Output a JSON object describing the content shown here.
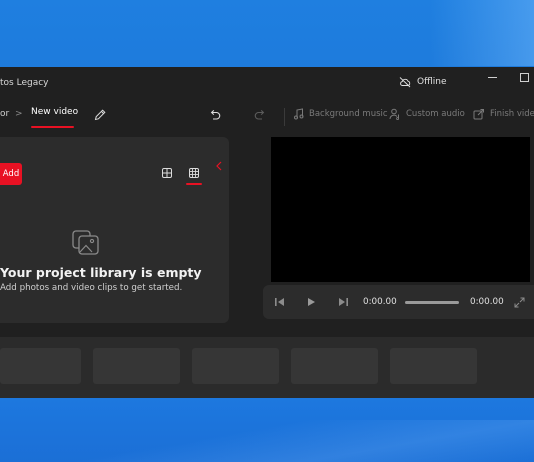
{
  "window": {
    "title": "tos Legacy",
    "status": "Offline",
    "status_icon": "cloud-off-icon"
  },
  "toolbar": {
    "breadcrumb_prev": "or",
    "breadcrumb_separator": ">",
    "breadcrumb_current": "New video",
    "background_music_label": "Background music",
    "custom_audio_label": "Custom audio",
    "finish_video_label": "Finish video"
  },
  "library": {
    "add_label": "Add",
    "empty_title": "Your project library is empty",
    "empty_subtitle": "Add photos and video clips to get started.",
    "selected_view": "grid-small"
  },
  "player": {
    "current_time": "0:00.00",
    "total_time": "0:00.00",
    "progress": 0
  },
  "storyboard": {
    "slot_count": 5
  },
  "colors": {
    "accent": "#e81123",
    "window_bg": "#202020",
    "panel_bg": "#2c2c2c",
    "desktop": "#1a70d2"
  }
}
